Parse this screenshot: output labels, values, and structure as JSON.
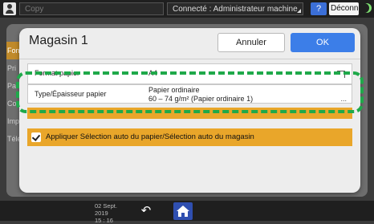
{
  "topbar": {
    "app_title": "Copy",
    "status": "Connecté : Administrateur machine",
    "help": "?",
    "logout": "Déconnexion"
  },
  "background": {
    "side_items": [
      "Fon",
      "Pri",
      "Pa",
      "Co",
      "Imp",
      "Télé"
    ]
  },
  "modal": {
    "title": "Magasin 1",
    "cancel_label": "Annuler",
    "ok_label": "OK",
    "rows": [
      {
        "label": "Format papier",
        "value": "A4"
      },
      {
        "label": "Type/Épaisseur papier",
        "value_line1": "Papier ordinaire",
        "value_line2": "60 – 74 g/m² (Papier ordinaire 1)",
        "more": "..."
      }
    ],
    "auto_select_label": "Appliquer Sélection auto du papier/Sélection auto du magasin",
    "auto_select_checked": true
  },
  "bottombar": {
    "date": "02 Sept. 2019",
    "time": "15 : 16"
  },
  "colors": {
    "accent_blue": "#3c7ee8",
    "highlight_green": "#1fa94a",
    "orange": "#e9a62a"
  }
}
